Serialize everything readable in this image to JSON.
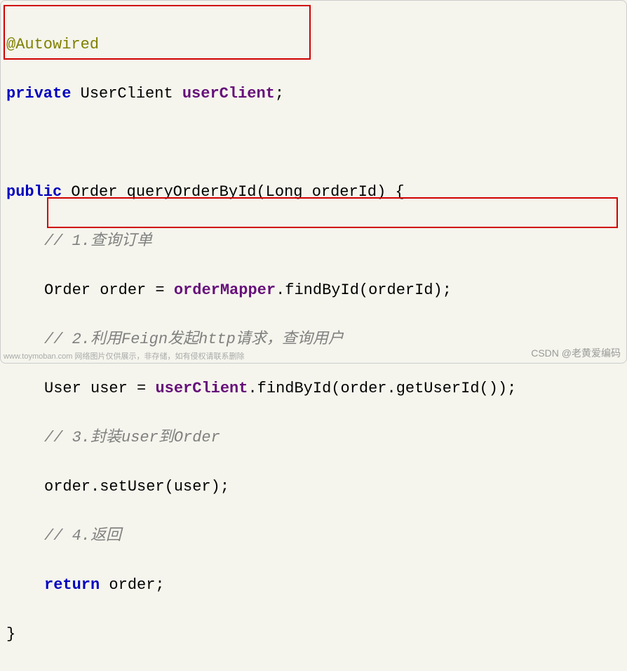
{
  "code": {
    "line1_annotation": "@Autowired",
    "line2_keyword": "private",
    "line2_type": " UserClient ",
    "line2_field": "userClient",
    "line2_semi": ";",
    "line4_keyword": "public",
    "line4_type": " Order ",
    "line4_method": "queryOrderById",
    "line4_params": "(Long orderId) {",
    "line5_comment": "// 1.查询订单",
    "line6_text1": "Order order = ",
    "line6_field": "orderMapper",
    "line6_text2": ".findById(orderId);",
    "line7_comment": "// 2.利用Feign发起http请求，查询用户",
    "line8_text1": "User user = ",
    "line8_field": "userClient",
    "line8_text2": ".findById(order.getUserId());",
    "line9_comment": "// 3.封装user到Order",
    "line10_text": "order.setUser(user);",
    "line11_comment": "// 4.返回",
    "line12_keyword": "return",
    "line12_text": " order;",
    "line13_brace": "}"
  },
  "watermark": {
    "left": "www.toymoban.com 网络图片仅供展示，非存储，如有侵权请联系删除",
    "right": "CSDN @老黄爱编码"
  }
}
